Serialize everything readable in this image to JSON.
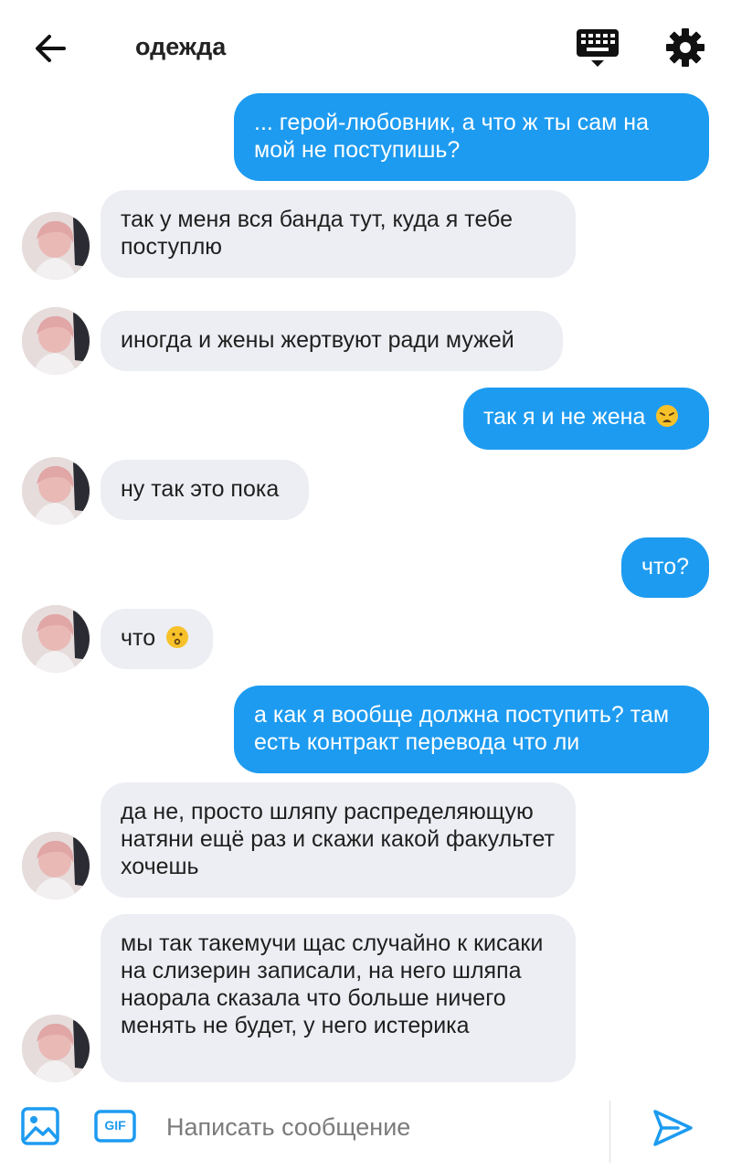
{
  "header": {
    "title": "одежда",
    "back_icon": "arrow-left-icon",
    "keyboard_icon": "keyboard-icon",
    "settings_icon": "gear-icon"
  },
  "messages": [
    {
      "side": "out",
      "text": "... герой-любовник, а что ж ты сам на мой не поступишь?"
    },
    {
      "side": "in",
      "text": "так у меня вся банда тут, куда я тебе поступлю"
    },
    {
      "side": "in",
      "text": "иногда и жены жертвуют ради мужей"
    },
    {
      "side": "out",
      "text": "так я и не жена",
      "emoji": "weary-face-emoji"
    },
    {
      "side": "in",
      "text": "ну так это пока"
    },
    {
      "side": "out",
      "text": "что?"
    },
    {
      "side": "in",
      "text": "что",
      "emoji": "kissing-face-emoji"
    },
    {
      "side": "out",
      "text": "а как я вообще должна поступить? там есть контракт перевода что ли"
    },
    {
      "side": "in",
      "text": "да не, просто шляпу распределяющую натяни ещё раз и скажи какой факультет хочешь"
    },
    {
      "side": "in",
      "text": "мы так такемучи щас случайно к кисаки на слизерин записали, на него шляпа наорала сказала что больше ничего менять не будет, у него истерика"
    }
  ],
  "composer": {
    "placeholder": "Написать сообщение",
    "gif_label": "GIF",
    "image_icon": "image-icon",
    "send_icon": "send-icon"
  },
  "colors": {
    "outgoing_bubble": "#1d9bf0",
    "incoming_bubble": "#eceef3",
    "accent": "#1d9bf0"
  }
}
